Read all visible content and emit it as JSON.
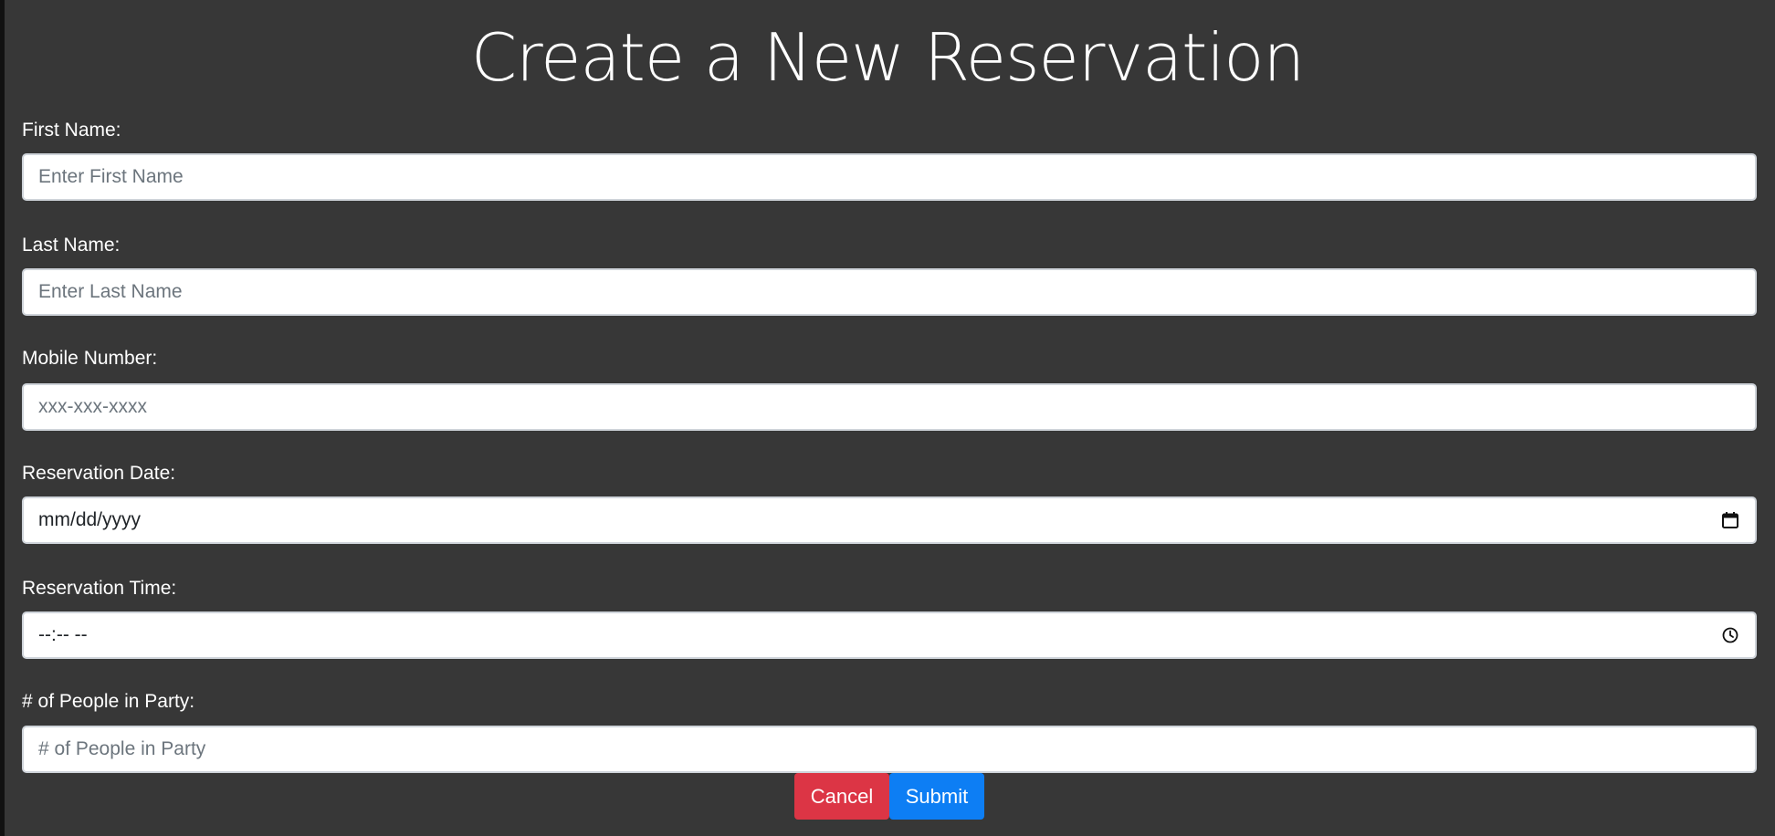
{
  "page": {
    "title": "Create a New Reservation"
  },
  "form": {
    "first_name": {
      "label": "First Name:",
      "placeholder": "Enter First Name",
      "value": ""
    },
    "last_name": {
      "label": "Last Name:",
      "placeholder": "Enter Last Name",
      "value": ""
    },
    "mobile_number": {
      "label": "Mobile Number:",
      "placeholder": "xxx-xxx-xxxx",
      "value": ""
    },
    "reservation_date": {
      "label": "Reservation Date:",
      "display_value": "mm/dd/yyyy",
      "icon": "calendar-icon"
    },
    "reservation_time": {
      "label": "Reservation Time:",
      "display_value": "--:-- --",
      "icon": "clock-icon"
    },
    "people": {
      "label": "# of People in Party:",
      "placeholder": "# of People in Party",
      "value": ""
    }
  },
  "buttons": {
    "cancel_label": "Cancel",
    "submit_label": "Submit"
  },
  "colors": {
    "background": "#373737",
    "cancel": "#dc3545",
    "submit": "#0d7ef4",
    "text": "#ffffff",
    "placeholder": "#6c757d"
  }
}
